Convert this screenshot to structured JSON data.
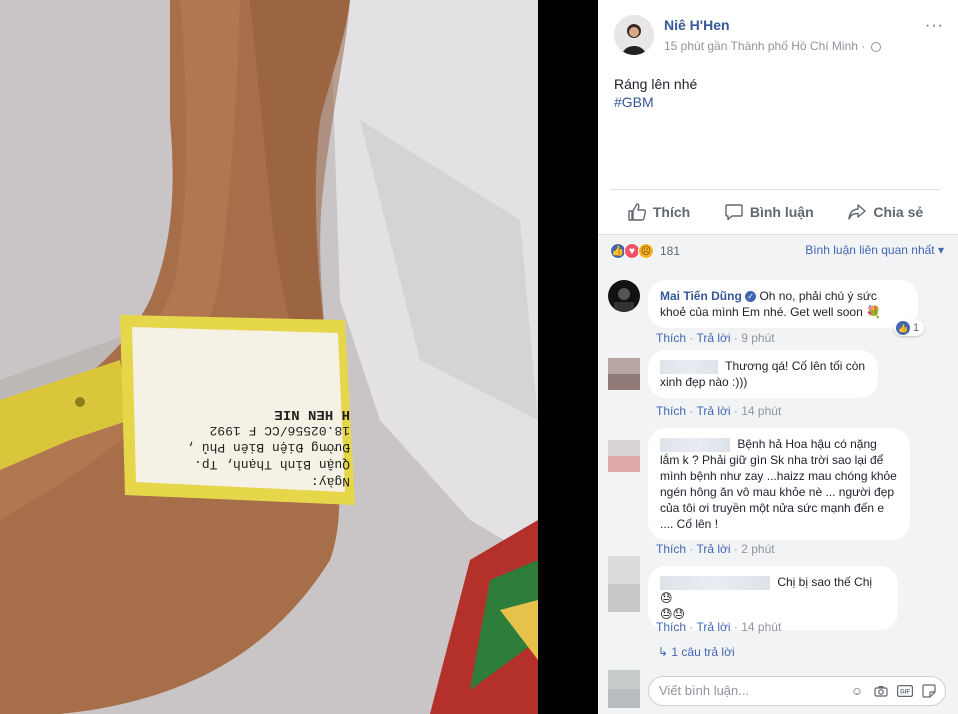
{
  "photo": {
    "band": {
      "name": "H HEN NIE",
      "line1": "18.02556/CC F 1992",
      "line2": "Đường Điện Biên Phủ ,",
      "line3": "Quận Bình Thạnh, Tp.",
      "line4": "Ngày:"
    }
  },
  "post": {
    "author": "Niê H'Hen",
    "meta": "15 phút gần Thành phố Hồ Chí Minh ·",
    "more": "···",
    "text": "Ráng lên nhé",
    "hashtag": "#GBM"
  },
  "actions": {
    "like": "Thích",
    "comment": "Bình luận",
    "share": "Chia sẻ"
  },
  "reactions": {
    "count": "181",
    "sort_label": "Bình luận liên quan nhất ▾"
  },
  "comments": [
    {
      "name": "Mai Tiến Dũng",
      "text": "Oh no, phải chú ý sức khoẻ của mình Em nhé. Get well soon 💐",
      "like": "Thích",
      "reply": "Trả lời",
      "time": "9 phút",
      "likes": "1"
    },
    {
      "text": "Thương qá! Cố lên tối còn xinh đẹp nào :)))",
      "like": "Thích",
      "reply": "Trả lời",
      "time": "14 phút"
    },
    {
      "text": "Bệnh hả Hoa hậu có nặng lắm k ? Phải giữ gìn Sk nha trời sao lại để mình bệnh như zay ...haizz mau chóng khỏe ngén hông ăn vô mau khỏe nè ... người đẹp của tôi ơi truyền một nửa sức mạnh đến e .... Cố lên !",
      "like": "Thích",
      "reply": "Trả lời",
      "time": "2 phút"
    },
    {
      "text": "Chị bị sao thế Chị 😓",
      "text2": "😓😓",
      "like": "Thích",
      "reply": "Trả lời",
      "time": "14 phút"
    }
  ],
  "replies": "↳ 1 câu trả lời",
  "input": {
    "placeholder": "Viết bình luận..."
  },
  "colors": {
    "link": "#365899",
    "accent": "#4267b2",
    "muted": "#90949c"
  }
}
